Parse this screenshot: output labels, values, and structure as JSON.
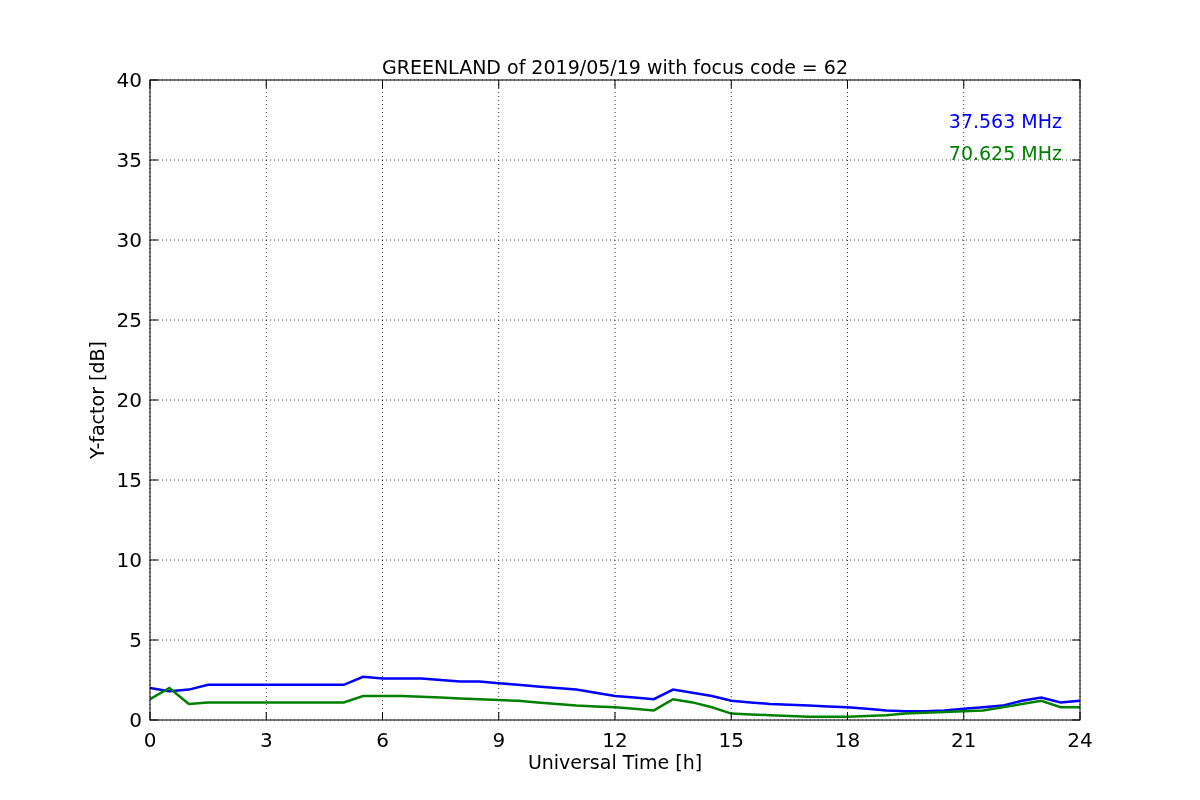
{
  "figure": {
    "chart_data": {
      "type": "line",
      "title": "GREENLAND of 2019/05/19 with focus code = 62",
      "xlabel": "Universal Time [h]",
      "ylabel": "Y-factor [dB]",
      "x": [
        0,
        0.5,
        1,
        1.5,
        2,
        2.5,
        3,
        3.5,
        4,
        4.5,
        5,
        5.5,
        6,
        6.5,
        7,
        7.5,
        8,
        8.5,
        9,
        9.5,
        10,
        10.5,
        11,
        11.5,
        12,
        12.5,
        13,
        13.5,
        14,
        14.5,
        15,
        15.5,
        16,
        16.5,
        17,
        17.5,
        18,
        18.5,
        19,
        19.5,
        20,
        20.5,
        21,
        21.5,
        22,
        22.5,
        23,
        23.5,
        24
      ],
      "series": [
        {
          "name": "37.563 MHz",
          "color": "#0000ff",
          "values": [
            2.0,
            1.8,
            1.9,
            2.2,
            2.2,
            2.2,
            2.2,
            2.2,
            2.2,
            2.2,
            2.2,
            2.7,
            2.6,
            2.6,
            2.6,
            2.5,
            2.4,
            2.4,
            2.3,
            2.2,
            2.1,
            2.0,
            1.9,
            1.7,
            1.5,
            1.4,
            1.3,
            1.9,
            1.7,
            1.5,
            1.2,
            1.1,
            1.0,
            0.95,
            0.9,
            0.85,
            0.8,
            0.7,
            0.6,
            0.55,
            0.55,
            0.6,
            0.7,
            0.8,
            0.9,
            1.2,
            1.4,
            1.1,
            1.2
          ]
        },
        {
          "name": "70.625 MHz",
          "color": "#008000",
          "values": [
            1.3,
            2.0,
            1.0,
            1.1,
            1.1,
            1.1,
            1.1,
            1.1,
            1.1,
            1.1,
            1.1,
            1.5,
            1.5,
            1.5,
            1.45,
            1.4,
            1.35,
            1.3,
            1.25,
            1.2,
            1.1,
            1.0,
            0.9,
            0.85,
            0.8,
            0.7,
            0.6,
            1.3,
            1.1,
            0.8,
            0.4,
            0.35,
            0.3,
            0.25,
            0.2,
            0.2,
            0.2,
            0.25,
            0.3,
            0.4,
            0.45,
            0.5,
            0.55,
            0.6,
            0.8,
            1.0,
            1.2,
            0.8,
            0.8
          ]
        }
      ],
      "xlim": [
        0,
        24
      ],
      "ylim": [
        0,
        40
      ],
      "xticks": [
        0,
        3,
        6,
        9,
        12,
        15,
        18,
        21,
        24
      ],
      "yticks": [
        0,
        5,
        10,
        15,
        20,
        25,
        30,
        35,
        40
      ],
      "grid": true
    }
  }
}
